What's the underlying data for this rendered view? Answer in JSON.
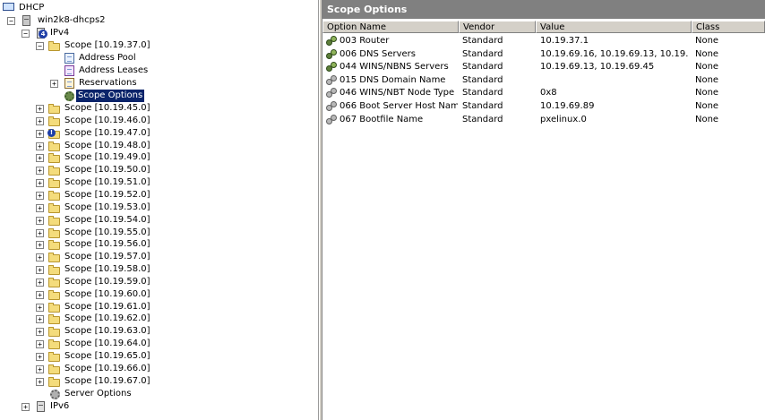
{
  "tree": {
    "root": "DHCP",
    "server": "win2k8-dhcps2",
    "ipv4": "IPv4",
    "active_scope": "Scope [10.19.37.0]",
    "scope_children": [
      "Address Pool",
      "Address Leases",
      "Reservations",
      "Scope Options"
    ],
    "scopes": [
      "Scope [10.19.45.0]",
      "Scope [10.19.46.0]",
      "Scope [10.19.47.0]",
      "Scope [10.19.48.0]",
      "Scope [10.19.49.0]",
      "Scope [10.19.50.0]",
      "Scope [10.19.51.0]",
      "Scope [10.19.52.0]",
      "Scope [10.19.53.0]",
      "Scope [10.19.54.0]",
      "Scope [10.19.55.0]",
      "Scope [10.19.56.0]",
      "Scope [10.19.57.0]",
      "Scope [10.19.58.0]",
      "Scope [10.19.59.0]",
      "Scope [10.19.60.0]",
      "Scope [10.19.61.0]",
      "Scope [10.19.62.0]",
      "Scope [10.19.63.0]",
      "Scope [10.19.64.0]",
      "Scope [10.19.65.0]",
      "Scope [10.19.66.0]",
      "Scope [10.19.67.0]"
    ],
    "server_options": "Server Options",
    "ipv6": "IPv6"
  },
  "details": {
    "title": "Scope Options",
    "columns": [
      "Option Name",
      "Vendor",
      "Value",
      "Class"
    ],
    "rows": [
      {
        "name": "003 Router",
        "vendor": "Standard",
        "value": "10.19.37.1",
        "class": "None"
      },
      {
        "name": "006 DNS Servers",
        "vendor": "Standard",
        "value": "10.19.69.16, 10.19.69.13, 10.19.6...",
        "class": "None"
      },
      {
        "name": "044 WINS/NBNS Servers",
        "vendor": "Standard",
        "value": "10.19.69.13, 10.19.69.45",
        "class": "None"
      },
      {
        "name": "015 DNS Domain Name",
        "vendor": "Standard",
        "value": "",
        "class": "None"
      },
      {
        "name": "046 WINS/NBT Node Type",
        "vendor": "Standard",
        "value": "0x8",
        "class": "None"
      },
      {
        "name": "066 Boot Server Host Name",
        "vendor": "Standard",
        "value": "10.19.69.89",
        "class": "None"
      },
      {
        "name": "067 Bootfile Name",
        "vendor": "Standard",
        "value": "pxelinux.0",
        "class": "None"
      }
    ]
  },
  "icons": {
    "root": "monitor-icon",
    "server": "server-icon",
    "ipv4": "ipv4-icon",
    "folder": "folder-icon",
    "address_pool": "address-pool-icon",
    "address_leases": "address-leases-icon",
    "reservations": "reservations-icon",
    "scope_options": "scope-options-icon",
    "server_options": "server-options-icon",
    "option": "gear-icon"
  },
  "colors": {
    "selection": "#0a246a",
    "title_bar": "#808080",
    "folder": "#f4dc7c"
  }
}
